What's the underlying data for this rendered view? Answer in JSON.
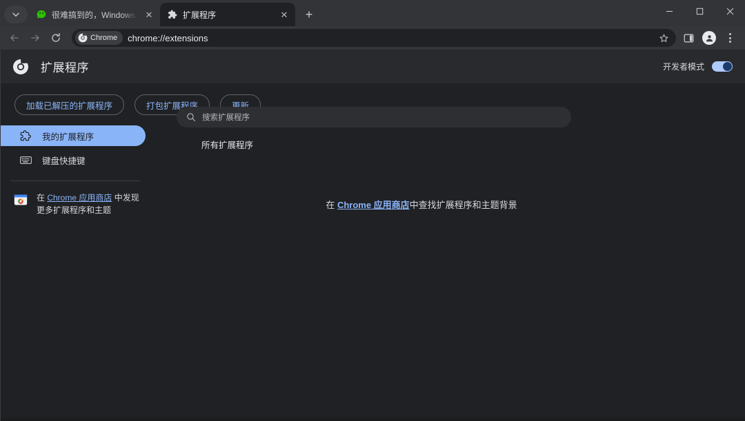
{
  "window": {
    "tab_search_icon": "chevron-down-icon",
    "minimize_label": "—",
    "maximize_label": "☐",
    "close_label": "✕",
    "newtab_label": "+"
  },
  "tabs": [
    {
      "title": "很难搞到的，Windows必装的",
      "favicon": "wechat-icon",
      "close_label": "✕",
      "active": false
    },
    {
      "title": "扩展程序",
      "favicon": "puzzle-icon",
      "close_label": "✕",
      "active": true
    }
  ],
  "toolbar": {
    "back_label": "←",
    "forward_label": "→",
    "reload_label": "⟳",
    "chrome_chip_label": "Chrome",
    "url": "chrome://extensions",
    "bookmark_label": "☆",
    "side_panel_label": "side-panel",
    "profile_label": "profile",
    "menu_label": "menu"
  },
  "extensions_page": {
    "title": "扩展程序",
    "search": {
      "placeholder": "搜索扩展程序",
      "value": ""
    },
    "dev_mode": {
      "label": "开发者模式",
      "enabled": "on"
    },
    "actions": [
      {
        "label": "加载已解压的扩展程序"
      },
      {
        "label": "打包扩展程序"
      },
      {
        "label": "更新"
      }
    ],
    "sidebar": {
      "items": [
        {
          "label": "我的扩展程序",
          "icon": "puzzle-icon",
          "selected": true
        },
        {
          "label": "键盘快捷键",
          "icon": "keyboard-icon",
          "selected": false
        }
      ],
      "store_promo": {
        "prefix": "在 ",
        "link": "Chrome 应用商店",
        "suffix": " 中发现更多扩展程序和主题",
        "icon": "chrome-web-store-icon"
      }
    },
    "main": {
      "section_title": "所有扩展程序",
      "empty_state": {
        "prefix": "在 ",
        "link": "Chrome 应用商店",
        "suffix": "中查找扩展程序和主题背景"
      }
    }
  },
  "colors": {
    "accent_blue": "#8ab4f8",
    "page_bg": "#202124",
    "header_bg": "#292a2d",
    "toolbar_bg": "#35363a",
    "tabstrip_bg": "#333438"
  }
}
